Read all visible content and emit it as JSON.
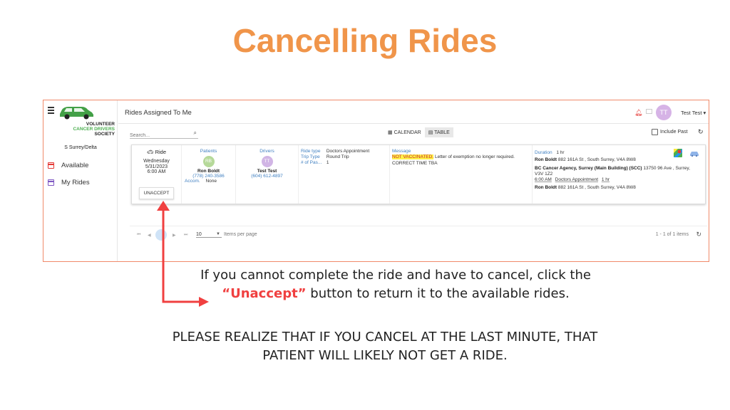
{
  "slide": {
    "title": "Cancelling Rides",
    "note_line1": "If you cannot complete the ride and have to cancel, click the",
    "note_highlight": "“Unaccept”",
    "note_line2_rest": " button to return it to the available rides.",
    "warning_line1": "PLEASE REALIZE THAT IF YOU CANCEL AT THE LAST MINUTE, THAT",
    "warning_line2": "PATIENT WILL LIKELY NOT GET A RIDE.",
    "accent_color": "#f0954a",
    "arrow_color": "#f04040"
  },
  "sidebar": {
    "logo_line1": "VOLUNTEER",
    "logo_line2": "CANCER DRIVERS",
    "logo_line3": "SOCIETY",
    "region": "S Surrey/Delta",
    "items": [
      {
        "label": "Available",
        "icon": "calendar-icon"
      },
      {
        "label": "My Rides",
        "icon": "calendar-check-icon"
      }
    ]
  },
  "header": {
    "title": "Rides Assigned To Me",
    "user_initials": "TT",
    "user_name": "Test Test ▾"
  },
  "toolbar": {
    "search_placeholder": "Search...",
    "calendar_label": "CALENDAR",
    "table_label": "TABLE",
    "include_past_label": "Include Past"
  },
  "ride": {
    "header": "Ride",
    "day": "Wednesday",
    "date": "5/31/2023",
    "time": "6:00 AM",
    "unaccept_label": "UNACCEPT",
    "patients_header": "Patients",
    "patient_initials": "RB",
    "patient_name": "Ron Boldt",
    "patient_phone": "(778) 240-3586",
    "accom_label": "Accom.",
    "accom_value": "None",
    "drivers_header": "Drivers",
    "driver_initials": "TT",
    "driver_name": "Test Test",
    "driver_phone": "(604) 612-4897",
    "ride_type_key": "Ride type",
    "ride_type_val": "Doctors Appointment",
    "trip_type_key": "Trip Type",
    "trip_type_val": "Round Trip",
    "pass_key": "# of Pas...",
    "pass_val": "1",
    "message_header": "Message",
    "msg_highlight": "NOT VACCINATED.",
    "msg_rest": " Letter of exemption no longer required.",
    "msg_line2": "CORRECT TIME TBA",
    "duration_label": "Duration",
    "duration_value": "1 hr",
    "pickup_name": "Ron Boldt",
    "pickup_addr": " 882 161A St , South Surrey, V4A 8W8",
    "dest_name": "BC Cancer Agency, Surrey (Main Building) (SCC)",
    "dest_addr": " 13750 96 Ave , Surrey,",
    "dest_addr2": "V3V 1Z2",
    "appt_time": "6:00 AM",
    "appt_type": "Doctors Appointment",
    "appt_duration": "1 hr",
    "return_name": "Ron Boldt",
    "return_addr": " 882 161A St , South Surrey, V4A 8W8"
  },
  "pagination": {
    "page_size": "10",
    "items_per_page_label": "Items per page",
    "range_label": "1 - 1 of 1 items"
  }
}
